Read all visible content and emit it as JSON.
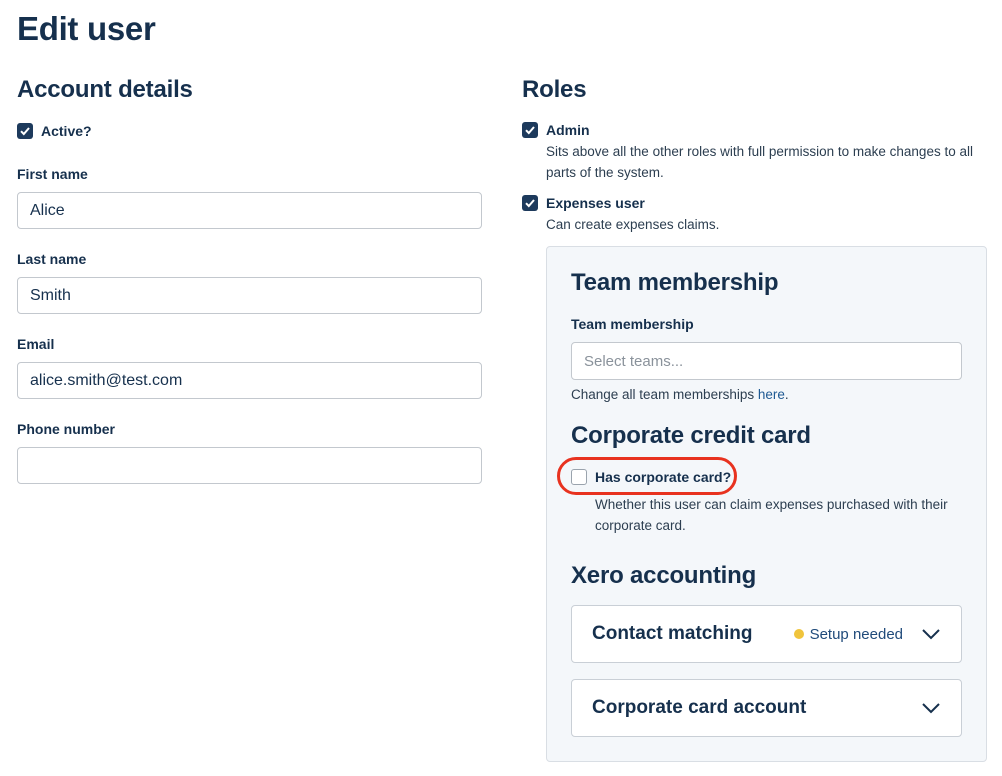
{
  "page_title": "Edit user",
  "account": {
    "heading": "Account details",
    "active_label": "Active?",
    "first_name": {
      "label": "First name",
      "value": "Alice"
    },
    "last_name": {
      "label": "Last name",
      "value": "Smith"
    },
    "email": {
      "label": "Email",
      "value": "alice.smith@test.com"
    },
    "phone": {
      "label": "Phone number",
      "value": ""
    }
  },
  "roles": {
    "heading": "Roles",
    "items": [
      {
        "label": "Admin",
        "checked": true,
        "description_line1": "Sits above all the other roles with full permission to make changes to all",
        "description_line2": "parts of the system."
      },
      {
        "label": "Expenses user",
        "checked": true,
        "description_line1": "Can create expenses claims."
      }
    ]
  },
  "team": {
    "heading": "Team membership",
    "field_label": "Team membership",
    "placeholder": "Select teams...",
    "help_prefix": "Change all team memberships ",
    "help_link": "here",
    "help_suffix": "."
  },
  "card": {
    "heading": "Corporate credit card",
    "checkbox_label": "Has corporate card?",
    "checked": false,
    "description_line1": "Whether this user can claim expenses purchased with their",
    "description_line2": "corporate card."
  },
  "xero": {
    "heading": "Xero accounting",
    "accordions": [
      {
        "title": "Contact matching",
        "status": "Setup needed",
        "status_color": "#f0c43c"
      },
      {
        "title": "Corporate card account"
      }
    ]
  },
  "colors": {
    "primary": "#16304d",
    "checkbox": "#1d3a5c",
    "highlight": "#e8321f",
    "link": "#1f5a93"
  }
}
